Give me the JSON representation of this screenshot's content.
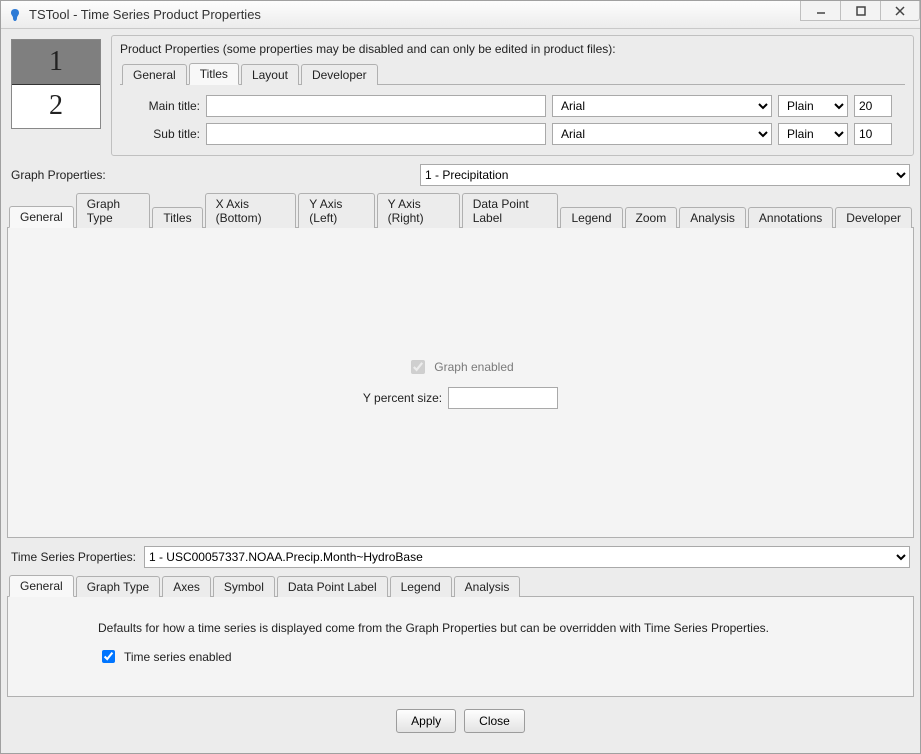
{
  "window": {
    "title": "TSTool - Time Series Product Properties"
  },
  "product": {
    "heading": "Product Properties (some properties may be disabled and can only be edited in product files):",
    "tabs": [
      "General",
      "Titles",
      "Layout",
      "Developer"
    ],
    "active_tab": "Titles",
    "titles": {
      "main_label": "Main title:",
      "sub_label": "Sub title:",
      "main_value": "",
      "sub_value": "",
      "font_main": "Arial",
      "font_sub": "Arial",
      "style_main": "Plain",
      "style_sub": "Plain",
      "size_main": "20",
      "size_sub": "10"
    }
  },
  "preview": {
    "top": "1",
    "bottom": "2"
  },
  "graph": {
    "section_label": "Graph Properties:",
    "selected": "1 - Precipitation",
    "tabs": [
      "General",
      "Graph Type",
      "Titles",
      "X Axis (Bottom)",
      "Y Axis (Left)",
      "Y Axis (Right)",
      "Data Point Label",
      "Legend",
      "Zoom",
      "Analysis",
      "Annotations",
      "Developer"
    ],
    "active_tab": "General",
    "general": {
      "enabled_label": "Graph enabled",
      "enabled": true,
      "ypercent_label": "Y percent size:",
      "ypercent_value": ""
    }
  },
  "ts": {
    "section_label": "Time Series Properties:",
    "selected": "1 - USC00057337.NOAA.Precip.Month~HydroBase",
    "tabs": [
      "General",
      "Graph Type",
      "Axes",
      "Symbol",
      "Data Point Label",
      "Legend",
      "Analysis"
    ],
    "active_tab": "General",
    "general": {
      "hint": "Defaults for how a time series is displayed come from the Graph Properties but can be overridden with Time Series Properties.",
      "enabled_label": "Time series enabled",
      "enabled": true
    }
  },
  "buttons": {
    "apply": "Apply",
    "close": "Close"
  }
}
